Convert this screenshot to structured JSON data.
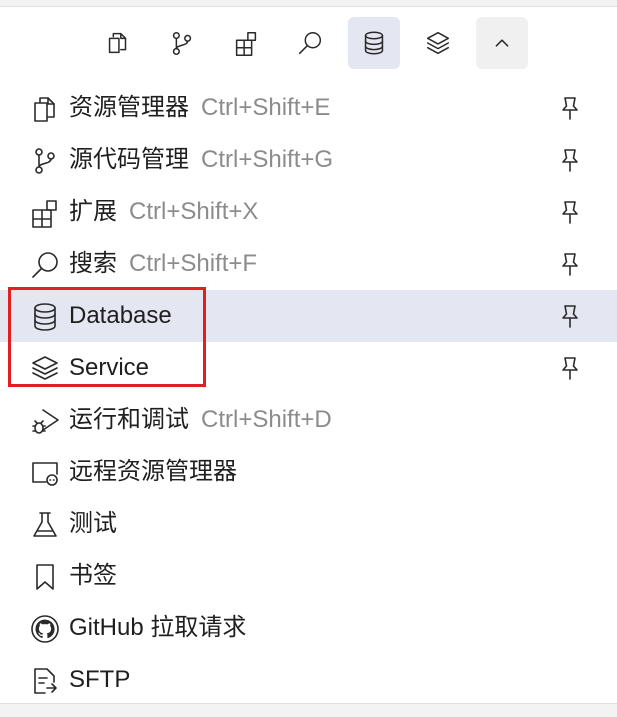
{
  "tabs": [
    {
      "name": "tab-explorer",
      "icon": "files-icon"
    },
    {
      "name": "tab-source-control",
      "icon": "git-branch-icon"
    },
    {
      "name": "tab-extensions",
      "icon": "extensions-icon"
    },
    {
      "name": "tab-search",
      "icon": "search-icon"
    },
    {
      "name": "tab-database",
      "icon": "database-icon",
      "active": true
    },
    {
      "name": "tab-service",
      "icon": "layers-icon"
    },
    {
      "name": "tab-more",
      "icon": "chevron-up-icon"
    }
  ],
  "items": [
    {
      "label": "资源管理器",
      "shortcut": "Ctrl+Shift+E",
      "icon": "files-icon",
      "pinned": true
    },
    {
      "label": "源代码管理",
      "shortcut": "Ctrl+Shift+G",
      "icon": "git-branch-icon",
      "pinned": true
    },
    {
      "label": "扩展",
      "shortcut": "Ctrl+Shift+X",
      "icon": "extensions-icon",
      "pinned": true
    },
    {
      "label": "搜索",
      "shortcut": "Ctrl+Shift+F",
      "icon": "search-icon",
      "pinned": true
    },
    {
      "label": "Database",
      "shortcut": "",
      "icon": "database-icon",
      "pinned": true
    },
    {
      "label": "Service",
      "shortcut": "",
      "icon": "layers-icon",
      "pinned": true
    },
    {
      "label": "运行和调试",
      "shortcut": "Ctrl+Shift+D",
      "icon": "run-debug-icon",
      "pinned": false
    },
    {
      "label": "远程资源管理器",
      "shortcut": "",
      "icon": "remote-explorer-icon",
      "pinned": false
    },
    {
      "label": "测试",
      "shortcut": "",
      "icon": "beaker-icon",
      "pinned": false
    },
    {
      "label": "书签",
      "shortcut": "",
      "icon": "bookmark-icon",
      "pinned": false
    },
    {
      "label": "GitHub 拉取请求",
      "shortcut": "",
      "icon": "github-icon",
      "pinned": false
    },
    {
      "label": "SFTP",
      "shortcut": "",
      "icon": "sftp-file-icon",
      "pinned": false
    }
  ],
  "colors": {
    "highlight": "#e4e6f1",
    "annotation_box": "#e02020",
    "shortcut_text": "#8c8c8c"
  }
}
